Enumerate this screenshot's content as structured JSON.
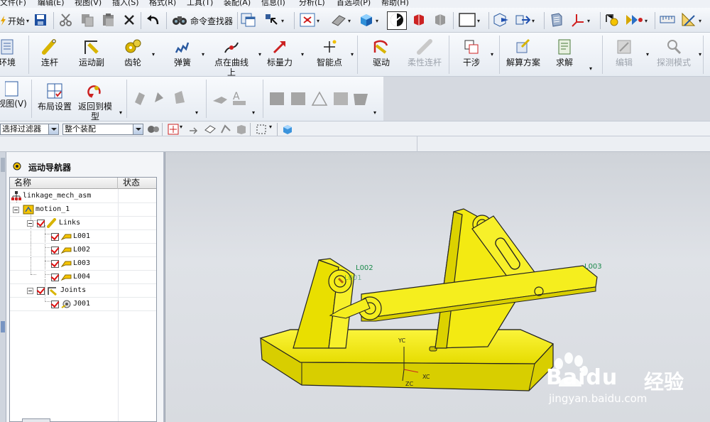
{
  "menu": [
    "文件(F)",
    "编辑(E)",
    "视图(V)",
    "插入(S)",
    "格式(R)",
    "工具(T)",
    "装配(A)",
    "信息(I)",
    "分析(L)",
    "首选项(P)",
    "帮助(H)"
  ],
  "toolbar": {
    "start_label": "开始",
    "command_finder_label": "命令查找器"
  },
  "ribbon": {
    "environment": "环境",
    "link": "连杆",
    "joint": "运动副",
    "gear": "齿轮",
    "spring": "弹簧",
    "point_on_curve": "点在曲线上",
    "marker_force": "标量力",
    "smart_point": "智能点",
    "driver": "驱动",
    "flexible_link": "柔性连杆",
    "interference": "干涉",
    "solution": "解算方案",
    "solve": "求解",
    "edit": "编辑",
    "probe_mode": "探测模式"
  },
  "ribbon2": {
    "view": "视图(V)",
    "layout_settings": "布局设置",
    "return_to_model": "返回到模型"
  },
  "filterbar": {
    "selection_filter": "选择过滤器",
    "scope": "整个装配"
  },
  "navigator": {
    "title": "运动导航器",
    "columns": [
      "名称",
      "状态"
    ],
    "rows": [
      {
        "name": "linkage_mech_asm"
      },
      {
        "name": "motion_1"
      },
      {
        "name": "Links"
      },
      {
        "name": "L001"
      },
      {
        "name": "L002"
      },
      {
        "name": "L003"
      },
      {
        "name": "L004"
      },
      {
        "name": "Joints"
      },
      {
        "name": "J001"
      }
    ]
  },
  "viewport": {
    "labels": {
      "l001": "L001",
      "l002": "L002",
      "l003": "L003",
      "yc": "YC",
      "xc": "XC",
      "zc": "ZC"
    },
    "watermark": {
      "brand": "Baidu",
      "cn": "经验",
      "url": "jingyan.baidu.com"
    },
    "model_color": "#f5ee1e"
  }
}
